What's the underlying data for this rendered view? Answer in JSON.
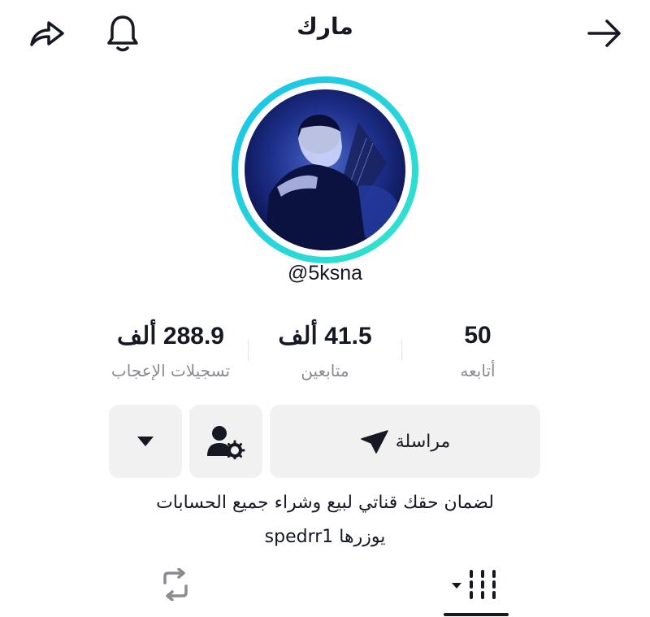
{
  "header": {
    "title": "مارك"
  },
  "profile": {
    "username": "@5ksna"
  },
  "stats": {
    "likes": {
      "value": "288.9 ألف",
      "label": "تسجيلات الإعجاب"
    },
    "followers": {
      "value": "41.5 ألف",
      "label": "متابعين"
    },
    "following": {
      "value": "50",
      "label": "أتابعه"
    }
  },
  "actions": {
    "message_label": "مراسلة"
  },
  "bio": {
    "line1": "لضمان حقك قناتي لبيع وشراء جميع الحسابات",
    "line2": "يوزرها spedrr1"
  },
  "icons": {
    "back": "arrow-right-icon",
    "notify": "bell-icon",
    "share": "share-icon",
    "message": "paper-plane-icon",
    "manage": "user-gear-icon",
    "more": "caret-down-icon",
    "videos_tab": "grid-bars-icon",
    "reposts_tab": "repost-icon"
  },
  "colors": {
    "ring_start": "#17c4e8",
    "ring_end": "#32e6c7",
    "button_bg": "#f1f1f2",
    "secondary_text": "#8a8b91"
  }
}
